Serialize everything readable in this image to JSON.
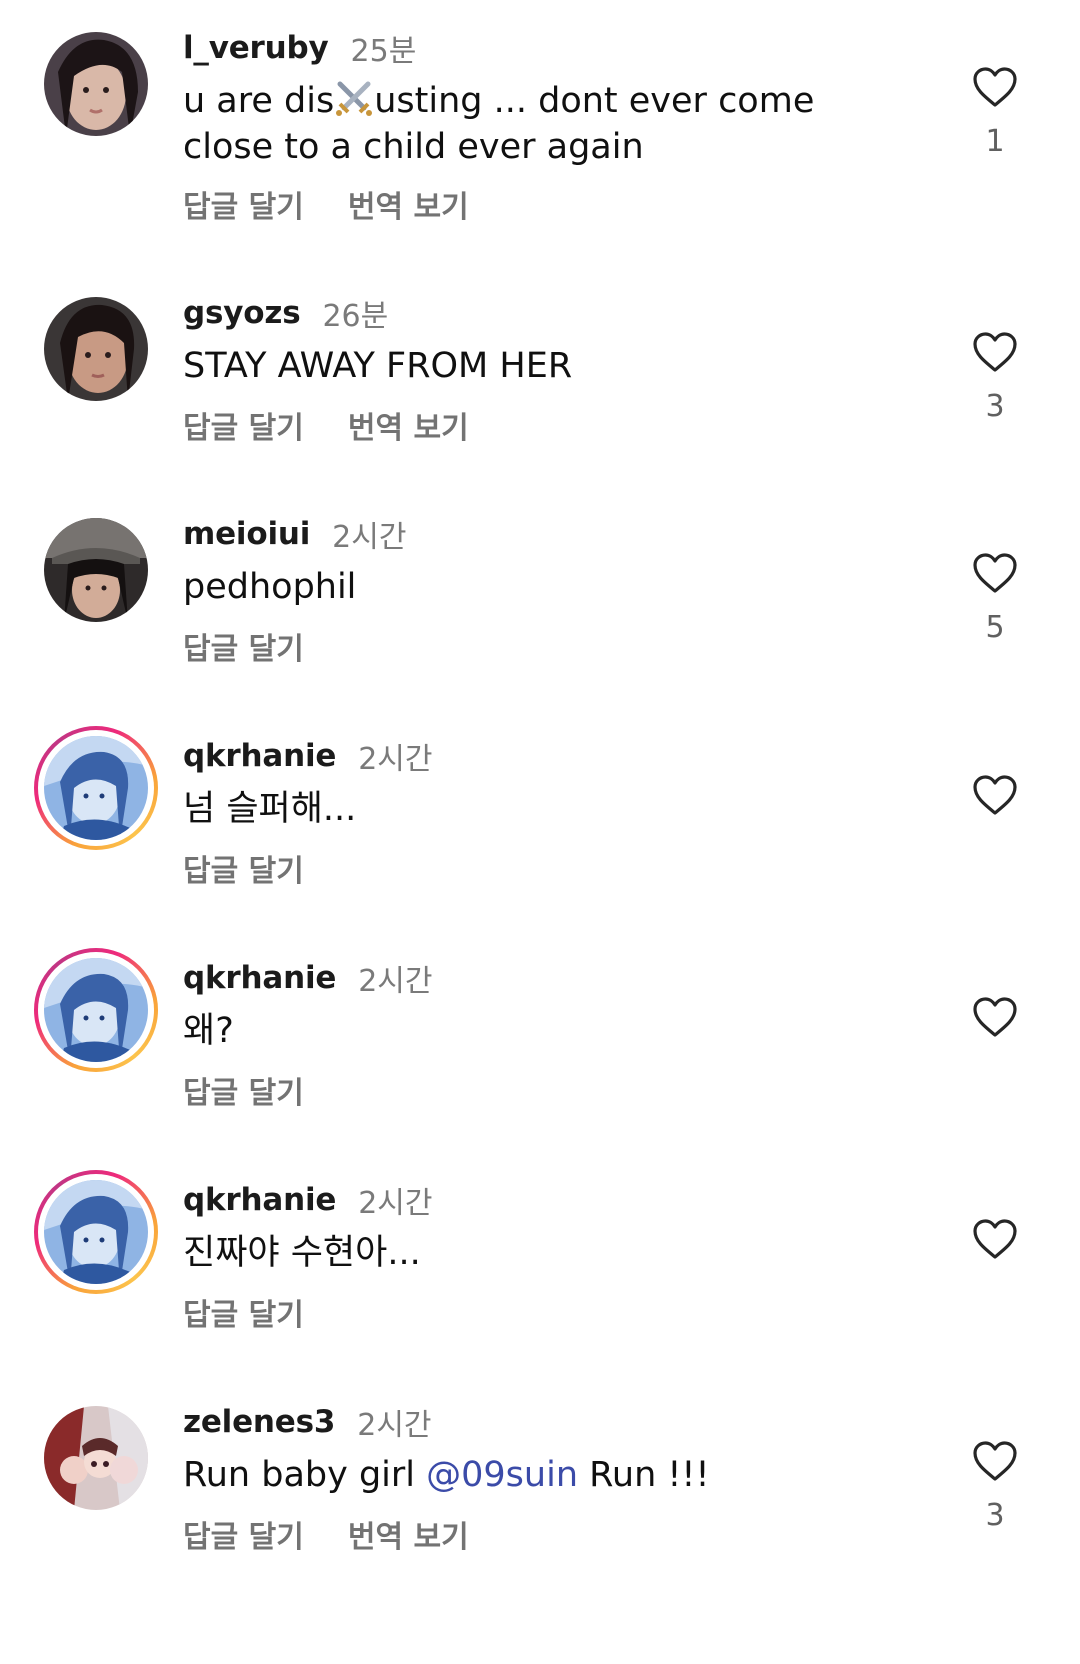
{
  "comments": [
    {
      "username": "l_veruby",
      "time": "25분",
      "text_before": "u are dis",
      "text_after": "usting ... dont ever come close to a child ever again",
      "reply_label": "답글 달기",
      "translate_label": "번역 보기",
      "likes": "1",
      "avatar_story_ring": false,
      "avatar_icon": "profile-photo"
    },
    {
      "username": "gsyozs",
      "time": "26분",
      "text": "STAY AWAY FROM HER",
      "reply_label": "답글 달기",
      "translate_label": "번역 보기",
      "likes": "3",
      "avatar_story_ring": false,
      "avatar_icon": "profile-photo"
    },
    {
      "username": "meioiui",
      "time": "2시간",
      "text": "pedhophil",
      "reply_label": "답글 달기",
      "likes": "5",
      "avatar_story_ring": false,
      "avatar_icon": "profile-photo"
    },
    {
      "username": "qkrhanie",
      "time": "2시간",
      "text": "넘 슬퍼해...",
      "reply_label": "답글 달기",
      "likes": "",
      "avatar_story_ring": true,
      "avatar_icon": "profile-photo"
    },
    {
      "username": "qkrhanie",
      "time": "2시간",
      "text": "왜?",
      "reply_label": "답글 달기",
      "likes": "",
      "avatar_story_ring": true,
      "avatar_icon": "profile-photo"
    },
    {
      "username": "qkrhanie",
      "time": "2시간",
      "text": "진짜야 수현아...",
      "reply_label": "답글 달기",
      "likes": "",
      "avatar_story_ring": true,
      "avatar_icon": "profile-photo"
    },
    {
      "username": "zelenes3",
      "time": "2시간",
      "text_before": "Run baby girl ",
      "mention": "@09suin",
      "text_after": " Run !!!",
      "reply_label": "답글 달기",
      "translate_label": "번역 보기",
      "likes": "3",
      "avatar_story_ring": false,
      "avatar_icon": "profile-photo"
    }
  ],
  "icons": {
    "like": "heart-outline-icon",
    "emoji": "crossed-swords-emoji"
  },
  "colors": {
    "username": "#1b1b1b",
    "meta": "#7a7a7a",
    "mention": "#3b4ba8",
    "story_ring_start": "#f9a33a",
    "story_ring_end": "#c13584"
  }
}
